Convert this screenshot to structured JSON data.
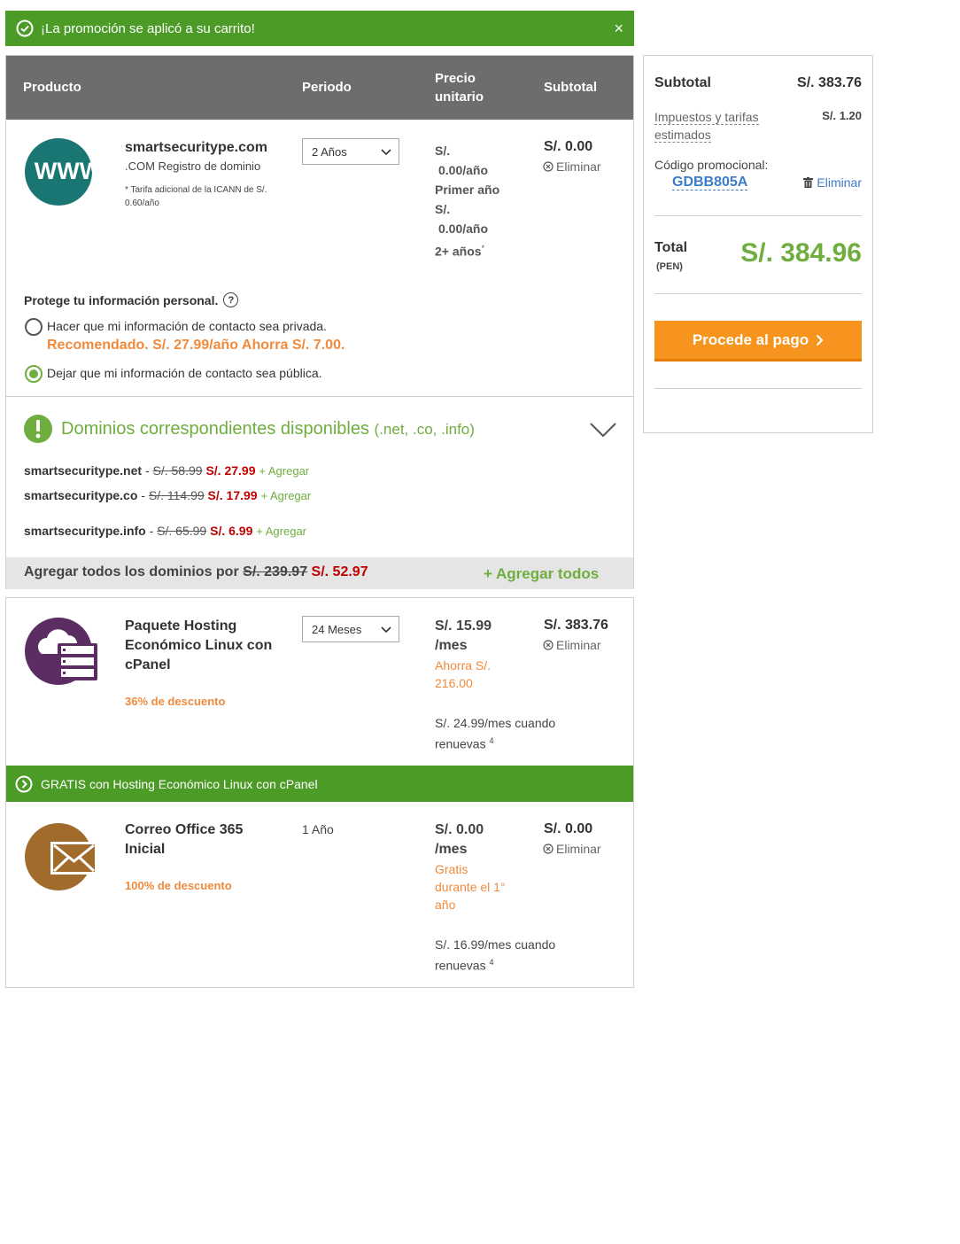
{
  "banner": {
    "message": "¡La promoción se aplicó a su carrito!",
    "close": "×",
    "color": "#4b9b26"
  },
  "table": {
    "headers": {
      "product": "Producto",
      "period": "Periodo",
      "unit_price_1": "Precio",
      "unit_price_2": "unitario",
      "subtotal": "Subtotal"
    }
  },
  "domain_item": {
    "icon_text": "WWW",
    "name": "smartsecuritype.com",
    "type": ".COM Registro de dominio",
    "note_1": "* Tarifa adicional de la ICANN de S/.",
    "note_2": "0.60/año",
    "period": "2 Años",
    "price_lines": [
      "S/.",
      "0.00/año",
      "Primer año",
      "S/.",
      "0.00/año",
      "2+ años"
    ],
    "price_sup": "*",
    "subtotal": "S/. 0.00",
    "remove": "Eliminar"
  },
  "privacy": {
    "title": "Protege tu información personal.",
    "help": "?",
    "private_option": "Hacer que mi información de contacto sea privada.",
    "recommended": "Recomendado. S/. 27.99/año Ahorra S/. 7.00.",
    "public_option": "Dejar que mi información de contacto sea pública."
  },
  "matching_domains": {
    "title": "Dominios correspondientes disponibles",
    "tlds": "(.net, .co, .info)",
    "items": [
      {
        "name": "smartsecuritype.net",
        "sep": " - ",
        "old_price": "S/. 58.99",
        "new_price": "S/. 27.99",
        "add": "+ Agregar"
      },
      {
        "name": "smartsecuritype.co",
        "sep": " - ",
        "old_price": "S/. 114.99",
        "new_price": "S/. 17.99",
        "add": "+ Agregar"
      },
      {
        "name": "smartsecuritype.info",
        "sep": " - ",
        "old_price": "S/. 65.99",
        "new_price": "S/. 6.99",
        "add": "+ Agregar"
      }
    ],
    "add_all_text": "Agregar todos los dominios por",
    "add_all_old": "S/. 239.97",
    "add_all_new": "S/. 52.97",
    "add_all_link": "+ Agregar todos"
  },
  "hosting_item": {
    "name_1": "Paquete Hosting",
    "name_2": "Económico Linux con",
    "name_3": "cPanel",
    "discount": "36% de descuento",
    "period": "24 Meses",
    "price_1": "S/. 15.99",
    "price_2": "/mes",
    "save_1": "Ahorra S/.",
    "save_2": "216.00",
    "renew_1": "S/. 24.99/mes cuando",
    "renew_2": "renuevas",
    "renew_sup": "4",
    "subtotal": "S/. 383.76",
    "remove": "Eliminar"
  },
  "free_bar": {
    "text": "GRATIS con Hosting Económico Linux con cPanel"
  },
  "email_item": {
    "name_1": "Correo Office 365",
    "name_2": "Inicial",
    "discount": "100% de descuento",
    "period": "1 Año",
    "price_1": "S/. 0.00",
    "price_2": "/mes",
    "free_1": "Gratis",
    "free_2": "durante el 1°",
    "free_3": "año",
    "renew_1": "S/. 16.99/mes cuando",
    "renew_2": "renuevas",
    "renew_sup": "4",
    "subtotal": "S/. 0.00",
    "remove": "Eliminar"
  },
  "summary": {
    "subtotal_label": "Subtotal",
    "subtotal_value": "S/. 383.76",
    "taxes_label_1": "Impuestos y tarifas",
    "taxes_label_2": "estimados",
    "taxes_value": "S/. 1.20",
    "promo_label": "Código promocional:",
    "promo_code": "GDBB805A",
    "promo_remove": "Eliminar",
    "total_label": "Total",
    "currency": "(PEN)",
    "total_value": "S/. 384.96",
    "checkout": "Procede al pago"
  }
}
